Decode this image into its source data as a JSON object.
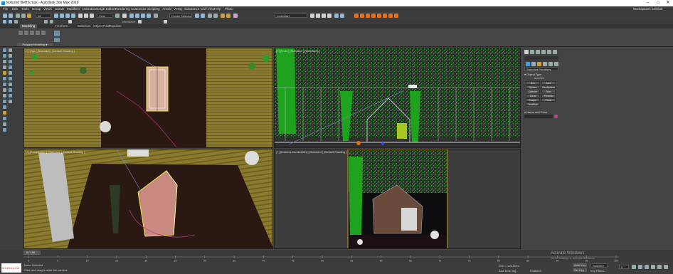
{
  "window": {
    "title": "textured fileHS.max - Autodesk 3ds Max 2019",
    "min": "–",
    "max": "□",
    "close": "✕"
  },
  "menu": {
    "items": [
      "File",
      "Edit",
      "Tools",
      "Group",
      "Views",
      "Create",
      "Modifiers",
      "Animation",
      "Graph Editors",
      "Rendering",
      "Customize",
      "Scripting",
      "Arnold",
      "V-Ray",
      "Substance",
      "Civil View",
      "Help",
      "Photo"
    ],
    "workspace": "Workspaces:  Default"
  },
  "toolbar": {
    "filter": "All",
    "view": "View",
    "selection_set": "Create Selection Se",
    "user": "LoginUser",
    "interactive": "Interactive"
  },
  "ribbon": {
    "tabs": [
      "Modeling",
      "Freeform",
      "Selection",
      "Object Paint",
      "Populate"
    ],
    "active_tab": "Modeling",
    "poly_button": "Polygon Modeling ▾"
  },
  "viewports": {
    "top": "[+] [Top ] [Standard ] [Default Shading ]",
    "front": "[+] [Front ] [Standard ] [Wireframe ]",
    "persp": "[+] [Perspective ] [Standard ] [Default Shading ]",
    "camera": "[+] [Camera-Camera001 ] [Standard ] [Default Shading ]"
  },
  "command_panel": {
    "category": "Standard Primitives",
    "object_type_header": "▾ Object Type",
    "autogrid": "AutoGrid",
    "buttons": [
      "Box",
      "Cone",
      "Sphere",
      "GeoSphere",
      "Cylinder",
      "Tube",
      "Torus",
      "Pyramid",
      "Teapot",
      "Plane",
      "TextPlus"
    ],
    "name_color_header": "▾ Name and Color"
  },
  "timeline": {
    "frame": "0 / 100",
    "ticks": [
      "0",
      "5",
      "10",
      "15",
      "20",
      "25",
      "30",
      "35",
      "40",
      "45",
      "50",
      "55",
      "60",
      "65",
      "70",
      "75",
      "80",
      "85",
      "90",
      "95",
      "100"
    ]
  },
  "status": {
    "maxscript": "MAXScript Mi",
    "selected": "None Selected",
    "hint": "Click and drag to slide the camera",
    "grid": "Grid = 100,0mm",
    "add_time_tag": "Add Time Tag",
    "watermark": "Activate Windows",
    "watermark2": "Go to Settings to activate Windows.",
    "auto_key": "Auto Key",
    "set_key": "Set Key",
    "selected_dd": "Selected",
    "key_filters": "Key Filters...",
    "frame_field": "0",
    "enabled": "Enabled:"
  },
  "colors": {
    "grass": "#8a7a2e",
    "dirt": "#2a1812",
    "foliage": "#1fa31f",
    "accent": "#e0701c",
    "selection": "#f5e642"
  }
}
